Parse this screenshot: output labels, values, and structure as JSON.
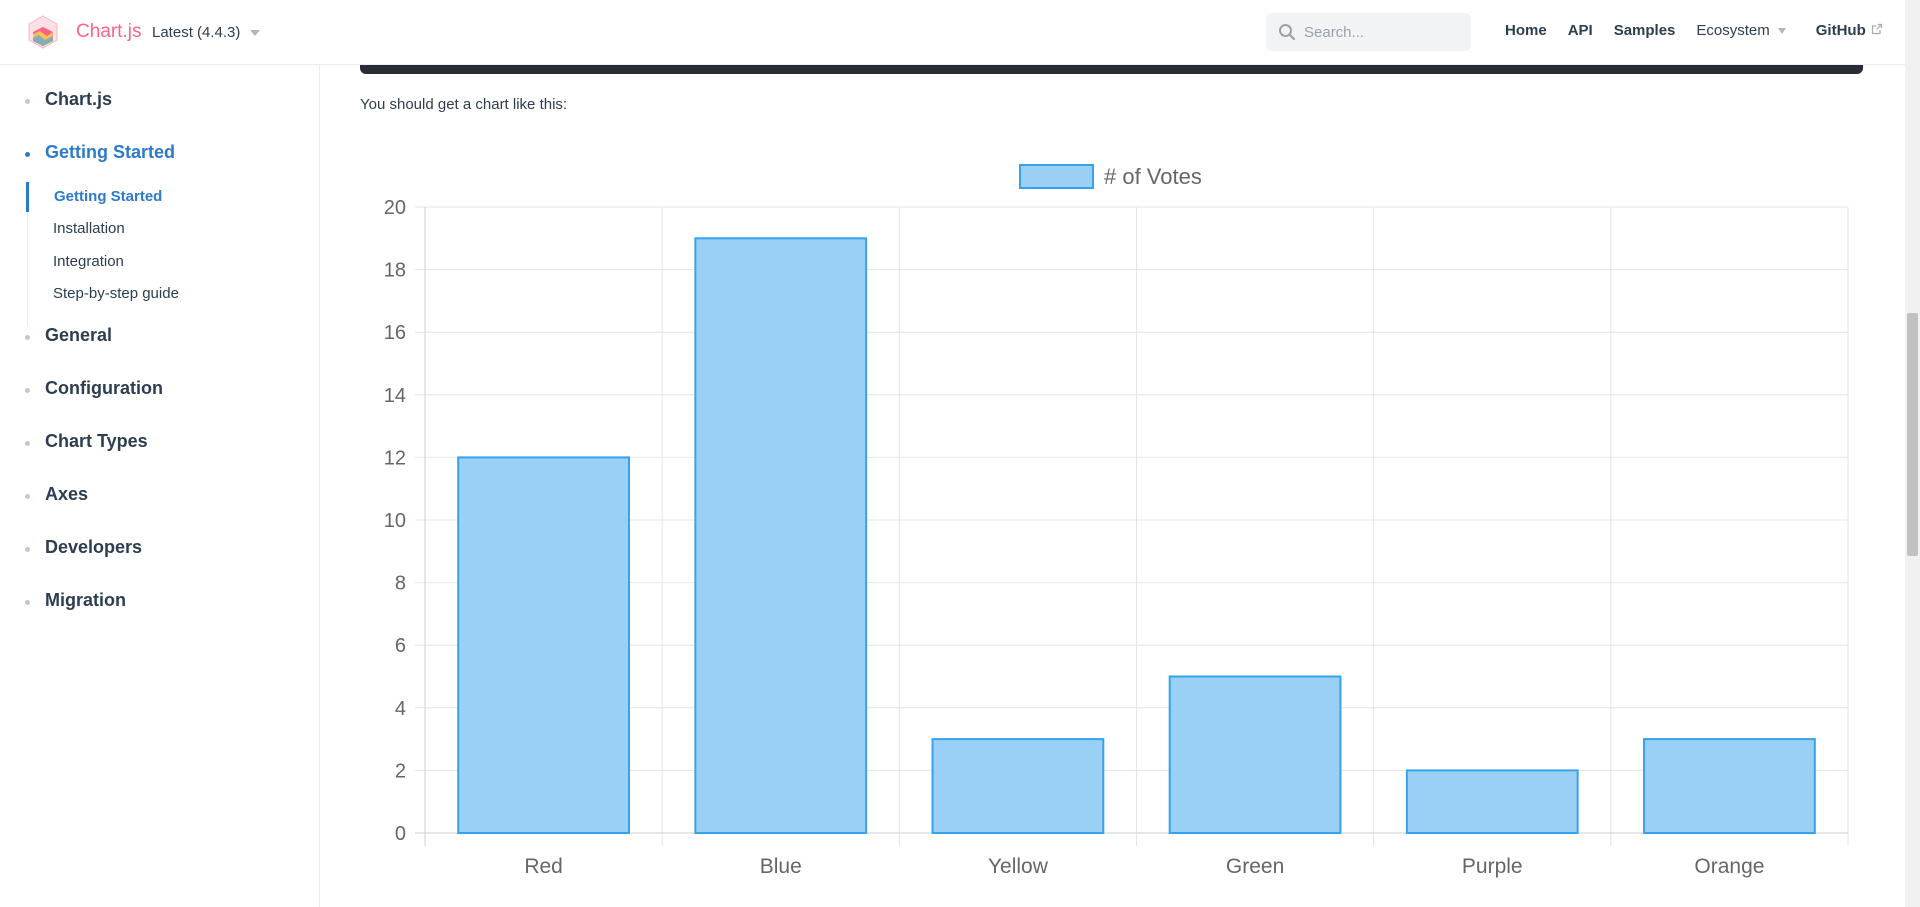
{
  "navbar": {
    "site_name": "Chart.js",
    "version": "Latest (4.4.3)",
    "search": {
      "placeholder": "Search..."
    },
    "links": [
      {
        "label": "Home"
      },
      {
        "label": "API"
      },
      {
        "label": "Samples"
      },
      {
        "label": "Ecosystem"
      },
      {
        "label": "GitHub"
      }
    ]
  },
  "sidebar": {
    "groups": [
      {
        "label": "Chart.js"
      },
      {
        "label": "Getting Started",
        "active": true
      },
      {
        "label": "General"
      },
      {
        "label": "Configuration"
      },
      {
        "label": "Chart Types"
      },
      {
        "label": "Axes"
      },
      {
        "label": "Developers"
      },
      {
        "label": "Migration"
      }
    ],
    "getting_started_items": [
      {
        "label": "Getting Started",
        "active": true
      },
      {
        "label": "Installation"
      },
      {
        "label": "Integration"
      },
      {
        "label": "Step-by-step guide"
      }
    ]
  },
  "content": {
    "intro": "You should get a chart like this:"
  },
  "colors": {
    "brand": "#ff6384",
    "accent": "#2c7acb",
    "bar_fill": "#9ad0f5",
    "bar_border": "#36a2eb"
  },
  "chart_data": {
    "type": "bar",
    "categories": [
      "Red",
      "Blue",
      "Yellow",
      "Green",
      "Purple",
      "Orange"
    ],
    "series": [
      {
        "name": "# of Votes",
        "values": [
          12,
          19,
          3,
          5,
          2,
          3
        ]
      }
    ],
    "ylim": [
      0,
      20
    ],
    "yticks": [
      "0",
      "2",
      "4",
      "6",
      "8",
      "10",
      "12",
      "14",
      "16",
      "18",
      "20"
    ],
    "grid": true,
    "legend": "top-center"
  }
}
